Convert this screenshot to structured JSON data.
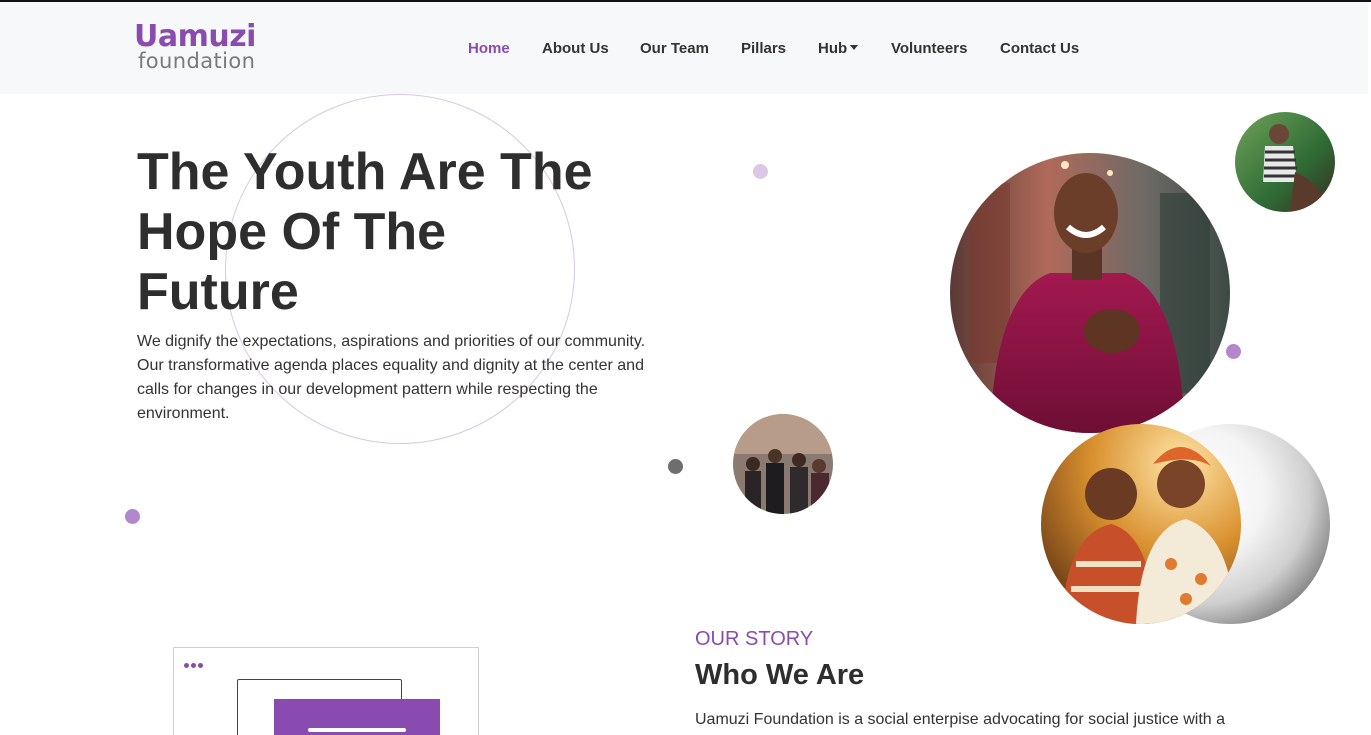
{
  "brand": {
    "logo_line1": "Uamuzi",
    "logo_line2": "foundation",
    "primary_color": "#8a4bb0"
  },
  "nav": {
    "items": [
      {
        "label": "Home",
        "active": true
      },
      {
        "label": "About Us"
      },
      {
        "label": "Our Team"
      },
      {
        "label": "Pillars"
      },
      {
        "label": "Hub",
        "dropdown": true
      },
      {
        "label": "Volunteers"
      },
      {
        "label": "Contact Us"
      }
    ]
  },
  "hero": {
    "title": "The Youth Are The Hope Of The Future",
    "text": "We dignify the expectations, aspirations and priorities of our community. Our transformative agenda places equality and dignity at the center and calls for changes in our development pattern while respecting the environment."
  },
  "story": {
    "kicker": "OUR STORY",
    "title": "Who We Are",
    "text": "Uamuzi Foundation is a social enterpise advocating for social justice with a"
  }
}
